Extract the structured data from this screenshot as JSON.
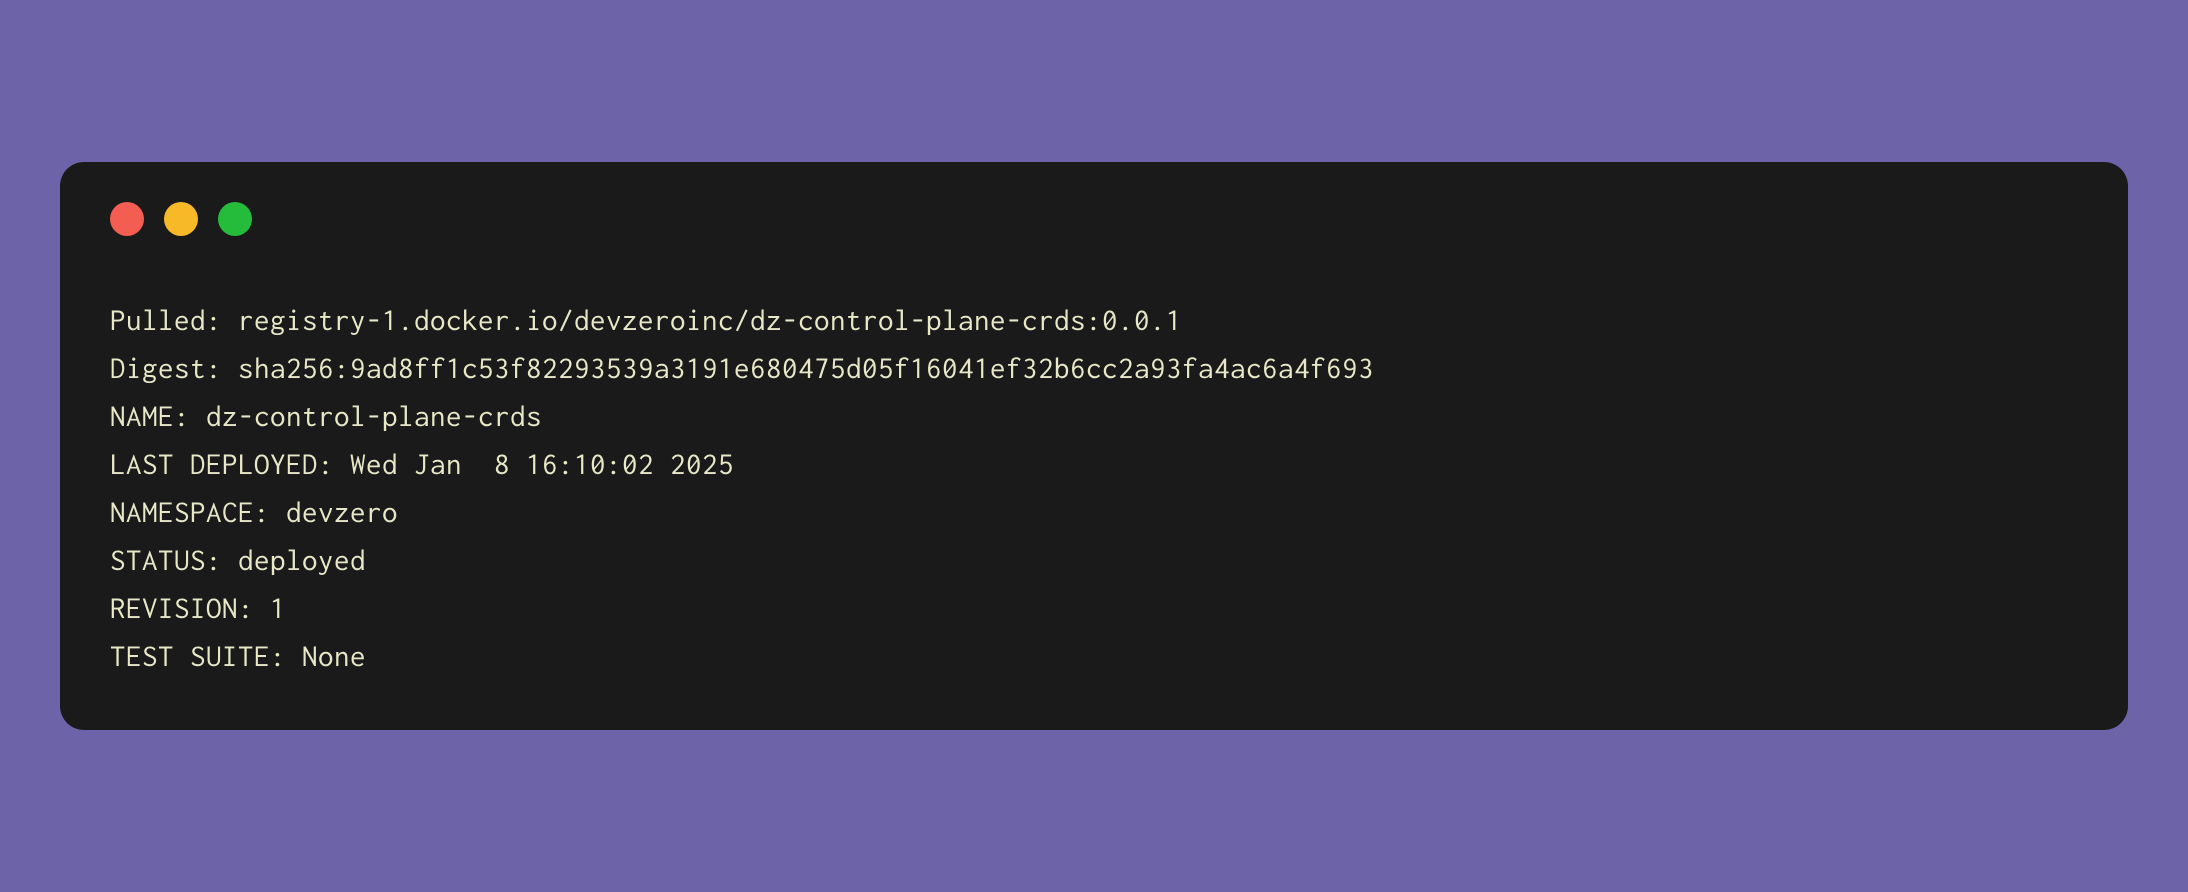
{
  "terminal": {
    "lines": [
      "Pulled: registry-1.docker.io/devzeroinc/dz-control-plane-crds:0.0.1",
      "Digest: sha256:9ad8ff1c53f82293539a3191e680475d05f16041ef32b6cc2a93fa4ac6a4f693",
      "NAME: dz-control-plane-crds",
      "LAST DEPLOYED: Wed Jan  8 16:10:02 2025",
      "NAMESPACE: devzero",
      "STATUS: deployed",
      "REVISION: 1",
      "TEST SUITE: None"
    ]
  }
}
